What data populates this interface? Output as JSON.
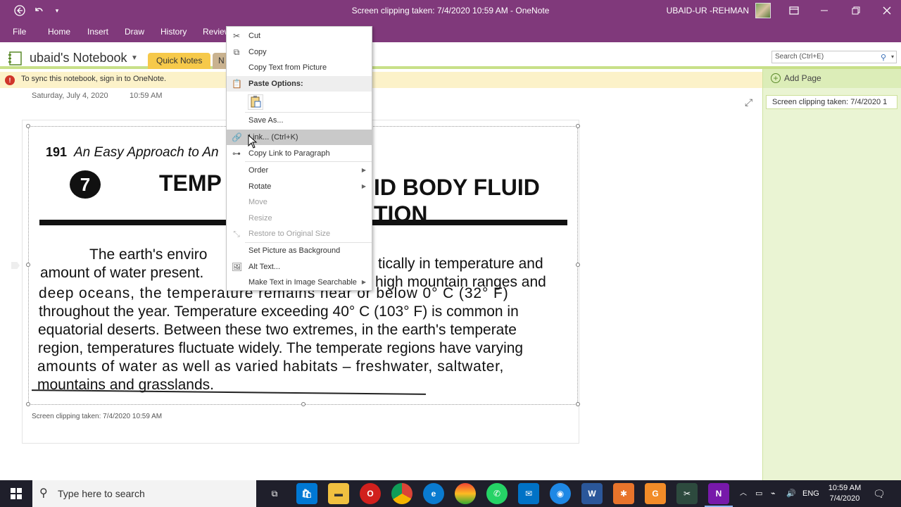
{
  "window": {
    "title": "Screen clipping taken: 7/4/2020 10:59 AM  -  OneNote",
    "user": "UBAID-UR -REHMAN"
  },
  "ribbon": {
    "tabs": [
      "File",
      "Home",
      "Insert",
      "Draw",
      "History",
      "Review"
    ]
  },
  "notebook": {
    "name": "ubaid's Notebook",
    "sections": [
      "Quick Notes",
      "N"
    ]
  },
  "search": {
    "placeholder": "Search (Ctrl+E)"
  },
  "sync_bar": {
    "message": "To sync this notebook, sign in to OneNote."
  },
  "page": {
    "date": "Saturday, July 4, 2020",
    "time": "10:59 AM",
    "caption": "Screen clipping taken: 7/4/2020 10:59 AM"
  },
  "scan": {
    "page_number": "191",
    "book_title": "An Easy Approach to An",
    "chapter": "7",
    "heading_left": "TEMP",
    "heading_right_1": "ID BODY FLUID",
    "heading_right_2": "TION",
    "lines": [
      "The earth's enviro",
      "tically in temperature and",
      "amount of water present.",
      "high mountain ranges and",
      "deep oceans, the temperature remains near or below 0° C (32° F)",
      "throughout the year. Temperature exceeding 40° C (103° F) is common in",
      "equatorial deserts. Between these two extremes, in the earth's temperate",
      "region, temperatures fluctuate widely. The temperate regions have varying",
      "amounts of water as well as varied habitats – freshwater, saltwater,",
      "mountains and grasslands."
    ]
  },
  "context_menu": {
    "cut": "Cut",
    "copy": "Copy",
    "copy_text": "Copy Text from Picture",
    "paste_options": "Paste Options:",
    "save_as": "Save As...",
    "link": "Link...  (Ctrl+K)",
    "copy_link": "Copy Link to Paragraph",
    "order": "Order",
    "rotate": "Rotate",
    "move": "Move",
    "resize": "Resize",
    "restore": "Restore to Original Size",
    "set_background": "Set Picture as Background",
    "alt_text": "Alt Text...",
    "make_searchable": "Make Text in Image Searchable"
  },
  "pages_pane": {
    "add_page": "Add Page",
    "pages": [
      "Screen clipping taken: 7/4/2020 1"
    ]
  },
  "taskbar": {
    "search_placeholder": "Type here to search",
    "language": "ENG",
    "time": "10:59 AM",
    "date": "7/4/2020"
  },
  "colors": {
    "onenote_purple": "#80397b",
    "section_tab": "#f6c94a",
    "pages_pane": "#eaf4d3"
  }
}
